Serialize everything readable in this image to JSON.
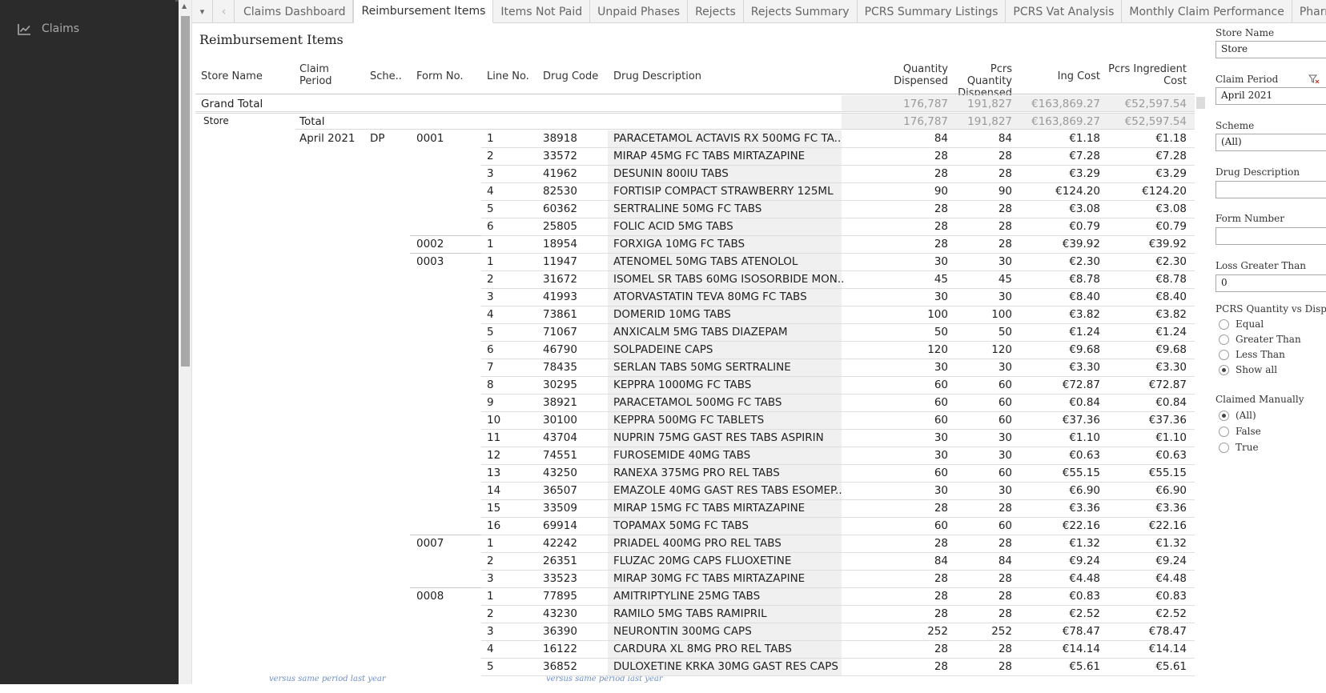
{
  "sidebar": {
    "items": [
      {
        "label": "Claims",
        "icon": "chart-line-icon"
      }
    ]
  },
  "tabs": {
    "dropdown_icon": "▾",
    "prev_icon": "‹",
    "items": [
      {
        "label": "Claims Dashboard",
        "active": false
      },
      {
        "label": "Reimbursement Items",
        "active": true
      },
      {
        "label": "Items Not Paid",
        "active": false
      },
      {
        "label": "Unpaid Phases",
        "active": false
      },
      {
        "label": "Rejects",
        "active": false
      },
      {
        "label": "Rejects Summary",
        "active": false
      },
      {
        "label": "PCRS Summary Listings",
        "active": false
      },
      {
        "label": "PCRS Vat Analysis",
        "active": false
      },
      {
        "label": "Monthly Claim Performance",
        "active": false
      },
      {
        "label": "Pharr",
        "active": false
      }
    ]
  },
  "report": {
    "title": "Reimbursement Items",
    "columns": {
      "store_name": "Store Name",
      "claim_period_1": "Claim",
      "claim_period_2": "Period",
      "scheme": "Sche..",
      "form_no": "Form No.",
      "line_no": "Line No.",
      "drug_code": "Drug Code",
      "drug_description": "Drug Description",
      "qty_1": "Quantity",
      "qty_2": "Dispensed",
      "pcrs_qty_1": "Pcrs Quantity",
      "pcrs_qty_2": "Dispensed",
      "ing_cost": "Ing Cost",
      "pcrs_ing_1": "Pcrs Ingredient",
      "pcrs_ing_2": "Cost"
    },
    "grand_total": {
      "label": "Grand Total",
      "quantity": "176,787",
      "pcrs_quantity": "191,827",
      "ing_cost": "€163,869.27",
      "pcrs_ing_cost": "€52,597.54"
    },
    "store": {
      "name": "Store",
      "total_label": "Total",
      "quantity": "176,787",
      "pcrs_quantity": "191,827",
      "ing_cost": "€163,869.27",
      "pcrs_ing_cost": "€52,597.54",
      "claim_period": "April 2021",
      "scheme": "DP"
    },
    "forms": [
      {
        "form": "0001",
        "lines": [
          [
            "1",
            "38918",
            "PARACETAMOL ACTAVIS RX 500MG FC TA..",
            "84",
            "84",
            "€1.18",
            "€1.18"
          ],
          [
            "2",
            "33572",
            "MIRAP 45MG FC TABS MIRTAZAPINE",
            "28",
            "28",
            "€7.28",
            "€7.28"
          ],
          [
            "3",
            "41962",
            "DESUNIN 800IU TABS",
            "28",
            "28",
            "€3.29",
            "€3.29"
          ],
          [
            "4",
            "82530",
            "FORTISIP COMPACT STRAWBERRY 125ML",
            "90",
            "90",
            "€124.20",
            "€124.20"
          ],
          [
            "5",
            "60362",
            "SERTRALINE 50MG FC TABS",
            "28",
            "28",
            "€3.08",
            "€3.08"
          ],
          [
            "6",
            "25805",
            "FOLIC ACID 5MG TABS",
            "28",
            "28",
            "€0.79",
            "€0.79"
          ]
        ]
      },
      {
        "form": "0002",
        "lines": [
          [
            "1",
            "18954",
            "FORXIGA 10MG FC TABS",
            "28",
            "28",
            "€39.92",
            "€39.92"
          ]
        ]
      },
      {
        "form": "0003",
        "lines": [
          [
            "1",
            "11947",
            "ATENOMEL 50MG TABS ATENOLOL",
            "30",
            "30",
            "€2.30",
            "€2.30"
          ],
          [
            "2",
            "31672",
            "ISOMEL SR TABS 60MG ISOSORBIDE MON..",
            "45",
            "45",
            "€8.78",
            "€8.78"
          ],
          [
            "3",
            "41993",
            "ATORVASTATIN TEVA 80MG FC TABS",
            "30",
            "30",
            "€8.40",
            "€8.40"
          ],
          [
            "4",
            "73861",
            "DOMERID 10MG TABS",
            "100",
            "100",
            "€3.82",
            "€3.82"
          ],
          [
            "5",
            "71067",
            "ANXICALM 5MG TABS DIAZEPAM",
            "50",
            "50",
            "€1.24",
            "€1.24"
          ],
          [
            "6",
            "46790",
            "SOLPADEINE CAPS",
            "120",
            "120",
            "€9.68",
            "€9.68"
          ],
          [
            "7",
            "78435",
            "SERLAN TABS 50MG SERTRALINE",
            "30",
            "30",
            "€3.30",
            "€3.30"
          ],
          [
            "8",
            "30295",
            "KEPPRA 1000MG FC TABS",
            "60",
            "60",
            "€72.87",
            "€72.87"
          ],
          [
            "9",
            "38921",
            "PARACETAMOL 500MG FC TABS",
            "60",
            "60",
            "€0.84",
            "€0.84"
          ],
          [
            "10",
            "30100",
            "KEPPRA 500MG FC TABLETS",
            "60",
            "60",
            "€37.36",
            "€37.36"
          ],
          [
            "11",
            "43704",
            "NUPRIN 75MG GAST RES TABS ASPIRIN",
            "30",
            "30",
            "€1.10",
            "€1.10"
          ],
          [
            "12",
            "74551",
            "FUROSEMIDE 40MG TABS",
            "30",
            "30",
            "€0.63",
            "€0.63"
          ],
          [
            "13",
            "43250",
            "RANEXA 375MG PRO REL TABS",
            "60",
            "60",
            "€55.15",
            "€55.15"
          ],
          [
            "14",
            "36507",
            "EMAZOLE 40MG GAST RES TABS ESOMEP..",
            "30",
            "30",
            "€6.90",
            "€6.90"
          ],
          [
            "15",
            "33509",
            "MIRAP 15MG FC TABS MIRTAZAPINE",
            "28",
            "28",
            "€3.36",
            "€3.36"
          ],
          [
            "16",
            "69914",
            "TOPAMAX 50MG FC TABS",
            "60",
            "60",
            "€22.16",
            "€22.16"
          ]
        ]
      },
      {
        "form": "0007",
        "lines": [
          [
            "1",
            "42242",
            "PRIADEL 400MG PRO REL TABS",
            "28",
            "28",
            "€1.32",
            "€1.32"
          ],
          [
            "2",
            "26351",
            "FLUZAC 20MG CAPS FLUOXETINE",
            "84",
            "84",
            "€9.24",
            "€9.24"
          ],
          [
            "3",
            "33523",
            "MIRAP 30MG FC TABS MIRTAZAPINE",
            "28",
            "28",
            "€4.48",
            "€4.48"
          ]
        ]
      },
      {
        "form": "0008",
        "lines": [
          [
            "1",
            "77895",
            "AMITRIPTYLINE 25MG TABS",
            "28",
            "28",
            "€0.83",
            "€0.83"
          ],
          [
            "2",
            "43230",
            "RAMILO 5MG TABS RAMIPRIL",
            "28",
            "28",
            "€2.52",
            "€2.52"
          ],
          [
            "3",
            "36390",
            "NEURONTIN 300MG CAPS",
            "252",
            "252",
            "€78.47",
            "€78.47"
          ],
          [
            "4",
            "16122",
            "CARDURA XL 8MG PRO REL TABS",
            "28",
            "28",
            "€14.14",
            "€14.14"
          ],
          [
            "5",
            "36852",
            "DULOXETINE KRKA 30MG GAST RES CAPS",
            "28",
            "28",
            "€5.61",
            "€5.61"
          ]
        ]
      }
    ]
  },
  "filters": {
    "store_name": {
      "label": "Store Name",
      "value": "Store"
    },
    "claim_period": {
      "label": "Claim Period",
      "value": "April 2021",
      "clear_icon": "filter-clear-icon"
    },
    "scheme": {
      "label": "Scheme",
      "value": "(All)"
    },
    "drug_description": {
      "label": "Drug Description",
      "value": ""
    },
    "form_number": {
      "label": "Form Number",
      "value": ""
    },
    "loss_greater_than": {
      "label": "Loss Greater Than",
      "value": "0"
    },
    "pcrs_quantity": {
      "label": "PCRS Quantity vs Dispen",
      "options": [
        {
          "label": "Equal",
          "selected": false
        },
        {
          "label": "Greater Than",
          "selected": false
        },
        {
          "label": "Less Than",
          "selected": false
        },
        {
          "label": "Show all",
          "selected": true
        }
      ]
    },
    "claimed_manually": {
      "label": "Claimed Manually",
      "options": [
        {
          "label": "(All)",
          "selected": true
        },
        {
          "label": "False",
          "selected": false
        },
        {
          "label": "True",
          "selected": false
        }
      ]
    }
  },
  "background_text": {
    "left": "versus same period last year",
    "right": "versus same period last year"
  },
  "colors": {
    "sidebar_bg": "#2b2b2b",
    "row_shade": "#f0f0f0",
    "total_text": "#9a9a9a"
  }
}
